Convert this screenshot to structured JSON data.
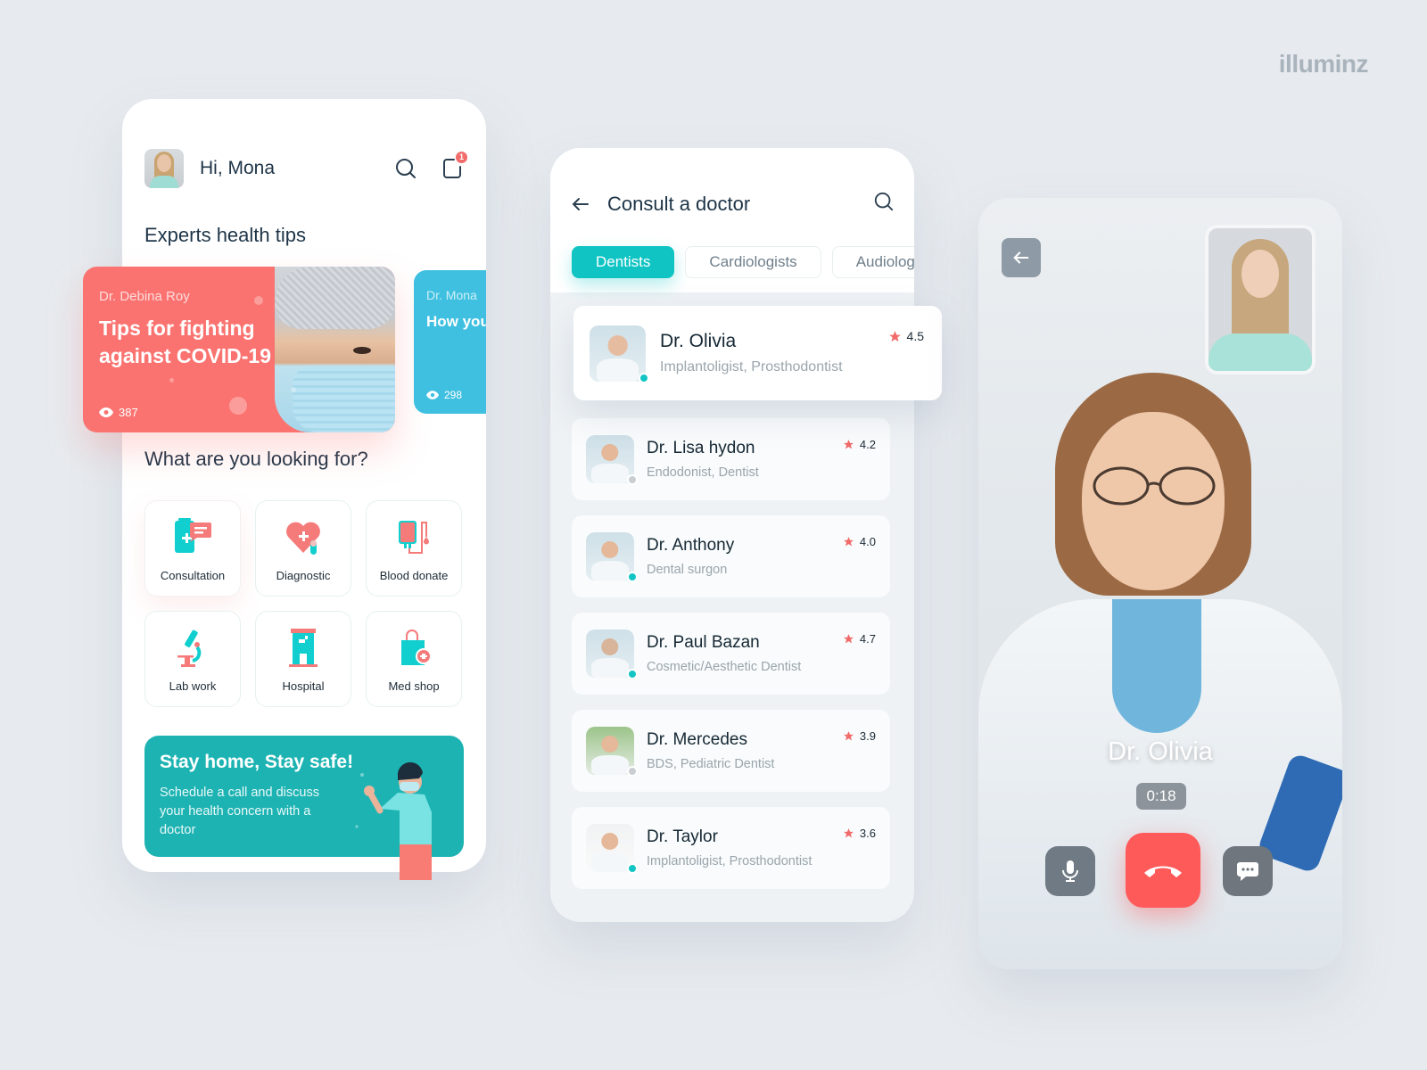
{
  "brand": "illuminz",
  "colors": {
    "accent_teal": "#11c4c4",
    "coral": "#fa7370",
    "sky": "#3fc0e0",
    "promo_teal": "#1eb3b3",
    "end_call": "#ff5a5a",
    "star": "#f26b6b"
  },
  "home": {
    "greeting": "Hi, Mona",
    "notification_count": "1",
    "icons": {
      "search": "search-icon",
      "notifications": "notification-icon"
    },
    "tips_title": "Experts health tips",
    "tips": [
      {
        "author": "Dr. Debina Roy",
        "title": "Tips for fighting against COVID-19",
        "views": "387"
      },
      {
        "author": "Dr. Mona",
        "title": "How you improve",
        "views": "298"
      }
    ],
    "categories_title": "What are you looking for?",
    "categories": [
      {
        "label": "Consultation",
        "icon": "consultation-icon"
      },
      {
        "label": "Diagnostic",
        "icon": "heart-plus-icon"
      },
      {
        "label": "Blood donate",
        "icon": "blood-bag-icon"
      },
      {
        "label": "Lab work",
        "icon": "microscope-icon"
      },
      {
        "label": "Hospital",
        "icon": "hospital-icon"
      },
      {
        "label": "Med shop",
        "icon": "shopping-bag-plus-icon"
      }
    ],
    "promo": {
      "title": "Stay home, Stay safe!",
      "body": "Schedule a call and discuss your health concern with a doctor"
    }
  },
  "consult": {
    "title": "Consult a doctor",
    "tabs": [
      {
        "label": "Dentists",
        "active": true
      },
      {
        "label": "Cardiologists",
        "active": false
      },
      {
        "label": "Audiologists",
        "active": false
      }
    ],
    "featured": {
      "name": "Dr. Olivia",
      "specialty": "Implantoligist, Prosthodontist",
      "rating": "4.5",
      "online": true
    },
    "doctors": [
      {
        "name": "Dr. Lisa hydon",
        "specialty": "Endodonist, Dentist",
        "rating": "4.2",
        "online": false
      },
      {
        "name": "Dr. Anthony",
        "specialty": "Dental surgon",
        "rating": "4.0",
        "online": true
      },
      {
        "name": "Dr. Paul Bazan",
        "specialty": "Cosmetic/Aesthetic Dentist",
        "rating": "4.7",
        "online": true
      },
      {
        "name": "Dr. Mercedes",
        "specialty": "BDS, Pediatric Dentist",
        "rating": "3.9",
        "online": false
      },
      {
        "name": "Dr. Taylor",
        "specialty": "Implantoligist, Prosthodontist",
        "rating": "3.6",
        "online": true
      }
    ]
  },
  "call": {
    "doctor_name": "Dr. Olivia",
    "duration": "0:18",
    "icons": {
      "back": "arrow-left-icon",
      "mic": "microphone-icon",
      "end": "phone-hangup-icon",
      "chat": "chat-bubble-icon"
    }
  }
}
